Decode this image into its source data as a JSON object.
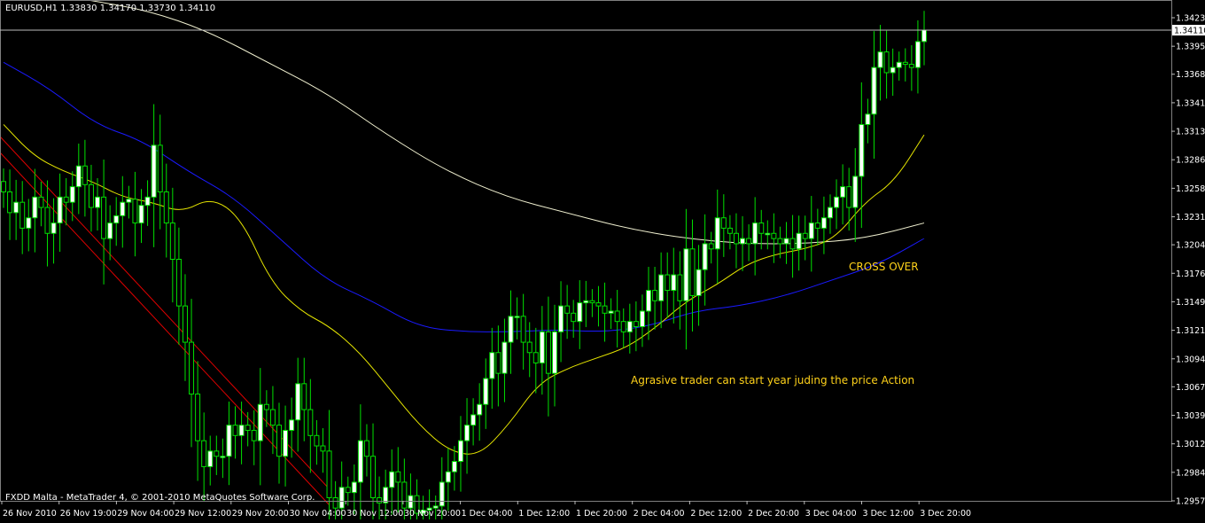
{
  "chart_data": {
    "type": "candlestick",
    "symbol_header": "EURUSD,H1  1.33830 1.34170 1.33730 1.34110",
    "footer": "FXDD Malta - MetaTrader 4, © 2001-2010 MetaQuotes Software Corp.",
    "ylim": [
      1.2957,
      1.3423
    ],
    "y_tick_labels": [
      "1.34230",
      "1.33955",
      "1.33685",
      "1.33410",
      "1.33135",
      "1.32860",
      "1.32585",
      "1.32310",
      "1.32040",
      "1.31765",
      "1.31490",
      "1.31215",
      "1.30940",
      "1.30670",
      "1.30395",
      "1.30120",
      "1.29845",
      "1.29570"
    ],
    "current_price": "1.34110",
    "x_tick_labels": [
      "26 Nov 2010",
      "26 Nov 19:00",
      "29 Nov 04:00",
      "29 Nov 12:00",
      "29 Nov 20:00",
      "30 Nov 04:00",
      "30 Nov 12:00",
      "30 Nov 20:00",
      "1 Dec 04:00",
      "1 Dec 12:00",
      "1 Dec 20:00",
      "2 Dec 04:00",
      "2 Dec 12:00",
      "2 Dec 20:00",
      "3 Dec 04:00",
      "3 Dec 12:00",
      "3 Dec 20:00"
    ],
    "annotations": [
      {
        "text": "CROSS OVER",
        "color": "#ffd21a"
      },
      {
        "text": "Agrasive trader can start year  juding the price Action",
        "color": "#ffd21a"
      }
    ],
    "colors": {
      "background": "#000000",
      "candle": "#00e000",
      "candle_bear_body": "#000000",
      "candle_bull_body": "#ffffff",
      "ma_fast": "#e6e600",
      "ma_mid": "#1a1aff",
      "ma_slow": "#f0f0d0",
      "channel": "#e00000",
      "grid_text": "#ffffff",
      "annotation": "#ffd21a"
    },
    "price_path": [
      1.3255,
      1.3235,
      1.3245,
      1.322,
      1.323,
      1.325,
      1.324,
      1.3215,
      1.3225,
      1.325,
      1.3245,
      1.326,
      1.328,
      1.3262,
      1.324,
      1.325,
      1.321,
      1.3225,
      1.3232,
      1.3245,
      1.3248,
      1.3225,
      1.3242,
      1.325,
      1.33,
      1.3255,
      1.3225,
      1.319,
      1.3145,
      1.311,
      1.306,
      1.3015,
      1.299,
      1.3005,
      1.3,
      1.3,
      1.303,
      1.302,
      1.303,
      1.3025,
      1.3015,
      1.305,
      1.3045,
      1.303,
      1.3,
      1.3025,
      1.3035,
      1.307,
      1.3045,
      1.302,
      1.301,
      1.3005,
      1.296,
      1.295,
      1.297,
      1.2965,
      1.2975,
      1.3015,
      1.3,
      1.296,
      1.2955,
      1.297,
      1.2985,
      1.2975,
      1.295,
      1.2962,
      1.2945,
      1.2948,
      1.295,
      1.2952,
      1.2975,
      1.2985,
      1.2995,
      1.3015,
      1.303,
      1.304,
      1.305,
      1.3075,
      1.31,
      1.308,
      1.311,
      1.3135,
      1.3135,
      1.311,
      1.31,
      1.309,
      1.312,
      1.308,
      1.312,
      1.3145,
      1.3138,
      1.313,
      1.3148,
      1.315,
      1.3148,
      1.3145,
      1.3138,
      1.314,
      1.313,
      1.312,
      1.313,
      1.3125,
      1.314,
      1.316,
      1.315,
      1.3175,
      1.316,
      1.3175,
      1.315,
      1.32,
      1.3155,
      1.318,
      1.3205,
      1.32,
      1.323,
      1.322,
      1.3215,
      1.3205,
      1.321,
      1.3205,
      1.3225,
      1.3215,
      1.3215,
      1.321,
      1.3205,
      1.321,
      1.32,
      1.3215,
      1.321,
      1.3225,
      1.322,
      1.323,
      1.324,
      1.325,
      1.326,
      1.324,
      1.327,
      1.332,
      1.333,
      1.3375,
      1.339,
      1.337,
      1.3375,
      1.338,
      1.3378,
      1.3375,
      1.34,
      1.3411
    ],
    "ma_fast_path": [
      1.332,
      1.329,
      1.3275,
      1.3265,
      1.325,
      1.3245,
      1.3235,
      1.325,
      1.323,
      1.3168,
      1.314,
      1.3125,
      1.31,
      1.3065,
      1.303,
      1.3005,
      1.3,
      1.303,
      1.307,
      1.3085,
      1.3095,
      1.3105,
      1.3125,
      1.315,
      1.3165,
      1.3185,
      1.3195,
      1.32,
      1.321,
      1.3245,
      1.3265,
      1.331
    ],
    "ma_mid_path": [
      1.338,
      1.3355,
      1.332,
      1.3305,
      1.3275,
      1.325,
      1.321,
      1.317,
      1.315,
      1.3125,
      1.312,
      1.312,
      1.3122,
      1.312,
      1.3125,
      1.314,
      1.3145,
      1.3155,
      1.317,
      1.3185,
      1.321
    ],
    "ma_slow_path": [
      1.344,
      1.343,
      1.341,
      1.338,
      1.335,
      1.331,
      1.3275,
      1.325,
      1.3235,
      1.322,
      1.321,
      1.3205,
      1.3205,
      1.321,
      1.3225
    ],
    "channel_offsets": [
      0,
      -18
    ]
  }
}
